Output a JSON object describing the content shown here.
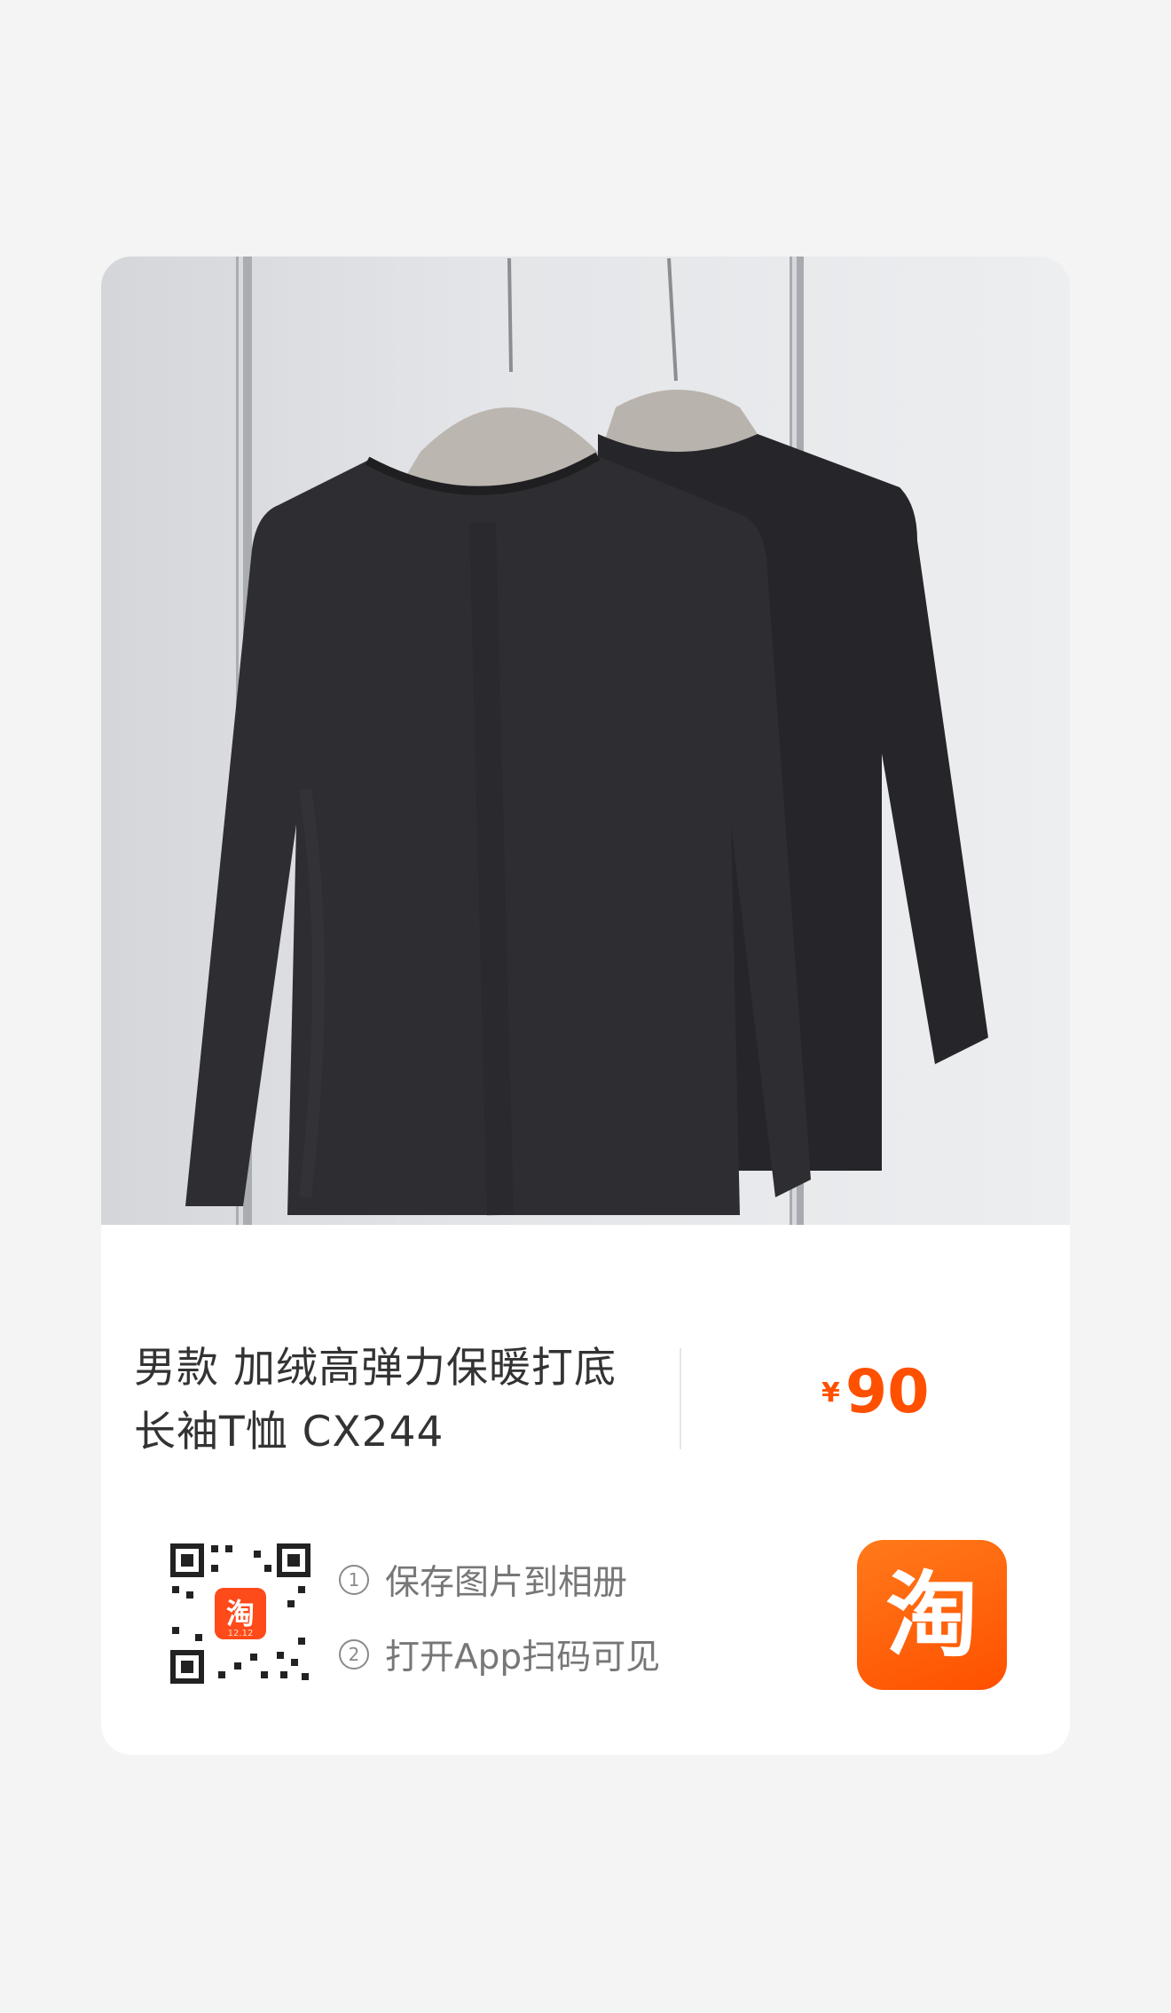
{
  "product": {
    "title_line1": "男款 加绒高弹力保暖打底",
    "title_line2": "长袖T恤 CX244",
    "currency_symbol": "¥",
    "price": "90",
    "image": "black long-sleeve t-shirts on hangers"
  },
  "instructions": {
    "step1_number": "1",
    "step1_text": "保存图片到相册",
    "step2_number": "2",
    "step2_text": "打开App扫码可见"
  },
  "qr": {
    "badge_text": "淘",
    "badge_subtext": "12.12"
  },
  "app_logo": {
    "text": "淘"
  },
  "colors": {
    "price": "#ff5000",
    "logo": "#ff5000",
    "shirt": "#2b2b2e"
  }
}
